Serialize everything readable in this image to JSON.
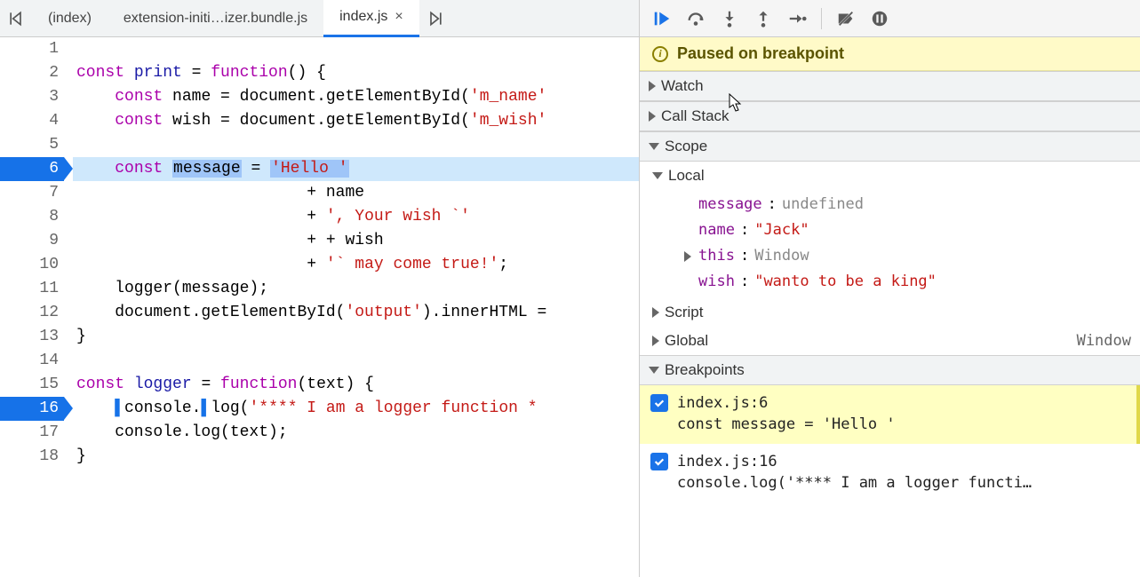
{
  "tabs": {
    "prev_icon": "tab-prev",
    "next_icon": "tab-next",
    "items": [
      {
        "label": "(index)",
        "active": false
      },
      {
        "label": "extension-initi…izer.bundle.js",
        "active": false
      },
      {
        "label": "index.js",
        "active": true
      }
    ]
  },
  "code": {
    "lines": [
      {
        "n": 1,
        "bp": false,
        "paused": false,
        "html": ""
      },
      {
        "n": 2,
        "bp": false,
        "paused": false,
        "html": "<span class='tok-kw'>const</span> <span class='tok-name'>print</span> = <span class='tok-kw'>function</span>() {"
      },
      {
        "n": 3,
        "bp": false,
        "paused": false,
        "html": "    <span class='tok-kw'>const</span> name = document.getElementById(<span class='tok-str'>'m_name'</span>"
      },
      {
        "n": 4,
        "bp": false,
        "paused": false,
        "html": "    <span class='tok-kw'>const</span> wish = document.getElementById(<span class='tok-str'>'m_wish'</span>"
      },
      {
        "n": 5,
        "bp": false,
        "paused": false,
        "html": ""
      },
      {
        "n": 6,
        "bp": true,
        "paused": true,
        "html": "    <span class='tok-kw'>const</span> <span class='tok-mark'>message</span> = <span class='tok-str tok-mark'>'Hello '</span>"
      },
      {
        "n": 7,
        "bp": false,
        "paused": false,
        "html": "                        + name"
      },
      {
        "n": 8,
        "bp": false,
        "paused": false,
        "html": "                        + <span class='tok-str'>', Your wish `'</span>"
      },
      {
        "n": 9,
        "bp": false,
        "paused": false,
        "html": "                        + + wish"
      },
      {
        "n": 10,
        "bp": false,
        "paused": false,
        "html": "                        + <span class='tok-str'>'` may come true!'</span>;"
      },
      {
        "n": 11,
        "bp": false,
        "paused": false,
        "html": "    logger(message);"
      },
      {
        "n": 12,
        "bp": false,
        "paused": false,
        "html": "    document.getElementById(<span class='tok-str'>'output'</span>).innerHTML = "
      },
      {
        "n": 13,
        "bp": false,
        "paused": false,
        "html": "}"
      },
      {
        "n": 14,
        "bp": false,
        "paused": false,
        "html": ""
      },
      {
        "n": 15,
        "bp": false,
        "paused": false,
        "html": "<span class='tok-kw'>const</span> <span class='tok-name'>logger</span> = <span class='tok-kw'>function</span>(text) {"
      },
      {
        "n": 16,
        "bp": true,
        "paused": false,
        "html": "    <span class='tok-bpmark'>▌</span>console.<span class='tok-bpmark'>▌</span>log(<span class='tok-str'>'**** I am a logger function *</span>"
      },
      {
        "n": 17,
        "bp": false,
        "paused": false,
        "html": "    console.log(text);"
      },
      {
        "n": 18,
        "bp": false,
        "paused": false,
        "html": "}"
      }
    ]
  },
  "debugger": {
    "status": "Paused on breakpoint",
    "buttons": {
      "resume": "Resume",
      "step_over": "Step over",
      "step_into": "Step into",
      "step_out": "Step out",
      "step": "Step",
      "deactivate": "Deactivate breakpoints",
      "pause_exceptions": "Pause on exceptions"
    },
    "sections": {
      "watch": "Watch",
      "call_stack": "Call Stack",
      "scope": "Scope",
      "breakpoints": "Breakpoints"
    },
    "scope": {
      "local_label": "Local",
      "script_label": "Script",
      "global_label": "Global",
      "global_value": "Window",
      "local_vars": [
        {
          "name": "message",
          "value": "undefined",
          "type": "undef",
          "expandable": false
        },
        {
          "name": "name",
          "value": "\"Jack\"",
          "type": "str",
          "expandable": false
        },
        {
          "name": "this",
          "value": "Window",
          "type": "obj",
          "expandable": true
        },
        {
          "name": "wish",
          "value": "\"wanto to be a king\"",
          "type": "str",
          "expandable": false
        }
      ]
    },
    "breakpoints": [
      {
        "location": "index.js:6",
        "snippet": "const message = 'Hello '",
        "checked": true,
        "active": true
      },
      {
        "location": "index.js:16",
        "snippet": "console.log('**** I am a logger functi…",
        "checked": true,
        "active": false
      }
    ]
  }
}
